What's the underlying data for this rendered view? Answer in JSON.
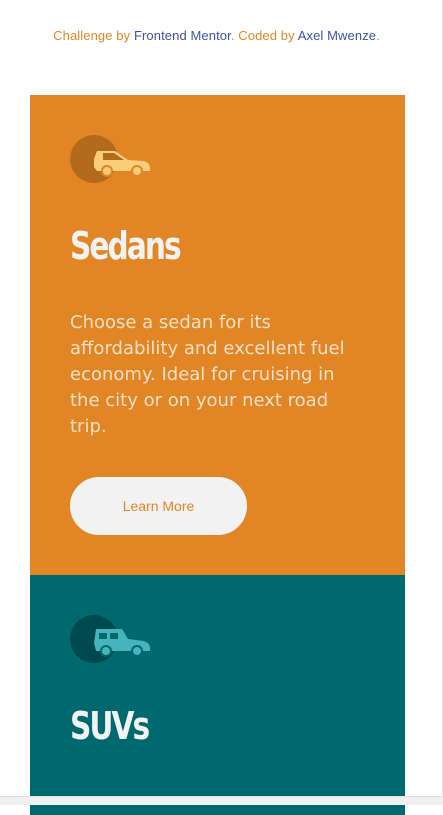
{
  "attribution": {
    "prefix": "Challenge by ",
    "challenge_link": "Frontend Mentor",
    "middle": ". Coded by ",
    "author_link": "Axel Mwenze",
    "suffix": "."
  },
  "cards": [
    {
      "icon": "sedan-car-icon",
      "title": "Sedans",
      "text": "Choose a sedan for its affordability and excellent fuel economy. Ideal for cruising in the city or on your next road trip.",
      "button_label": "Learn More",
      "bg_color": "#e28625",
      "icon_color": "#f9cd7a"
    },
    {
      "icon": "suv-car-icon",
      "title": "SUVs",
      "bg_color": "#006970",
      "icon_color": "#47b3bc"
    }
  ]
}
